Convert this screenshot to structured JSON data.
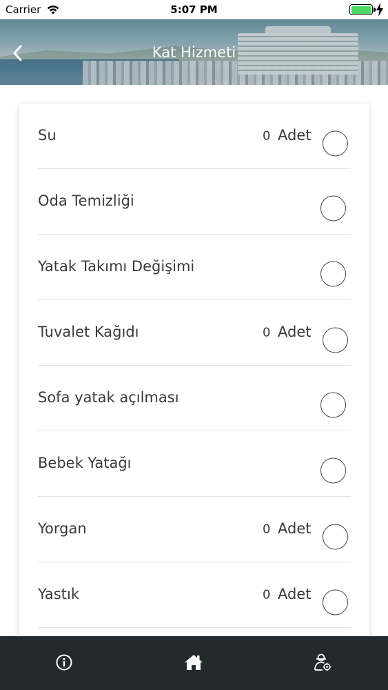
{
  "status_bar": {
    "carrier": "Carrier",
    "time": "5:07 PM",
    "battery_level": 1.0
  },
  "header": {
    "title": "Kat Hizmeti",
    "back_icon": "chevron-left-icon"
  },
  "services": [
    {
      "label": "Su",
      "quantity": "0",
      "unit": "Adet",
      "has_quantity": true
    },
    {
      "label": "Oda Temizliği",
      "has_quantity": false
    },
    {
      "label": "Yatak Takımı Değişimi",
      "has_quantity": false
    },
    {
      "label": "Tuvalet Kağıdı",
      "quantity": "0",
      "unit": "Adet",
      "has_quantity": true
    },
    {
      "label": "Sofa yatak açılması",
      "has_quantity": false
    },
    {
      "label": "Bebek Yatağı",
      "has_quantity": false
    },
    {
      "label": "Yorgan",
      "quantity": "0",
      "unit": "Adet",
      "has_quantity": true
    },
    {
      "label": "Yastık",
      "quantity": "0",
      "unit": "Adet",
      "has_quantity": true
    }
  ],
  "tab_bar": {
    "items": [
      {
        "icon": "info-icon"
      },
      {
        "icon": "home-icon"
      },
      {
        "icon": "staff-settings-icon"
      }
    ]
  },
  "colors": {
    "tab_bar_background": "#232a2c",
    "battery_fill": "#4cd964",
    "text": "#3a3a3a"
  }
}
